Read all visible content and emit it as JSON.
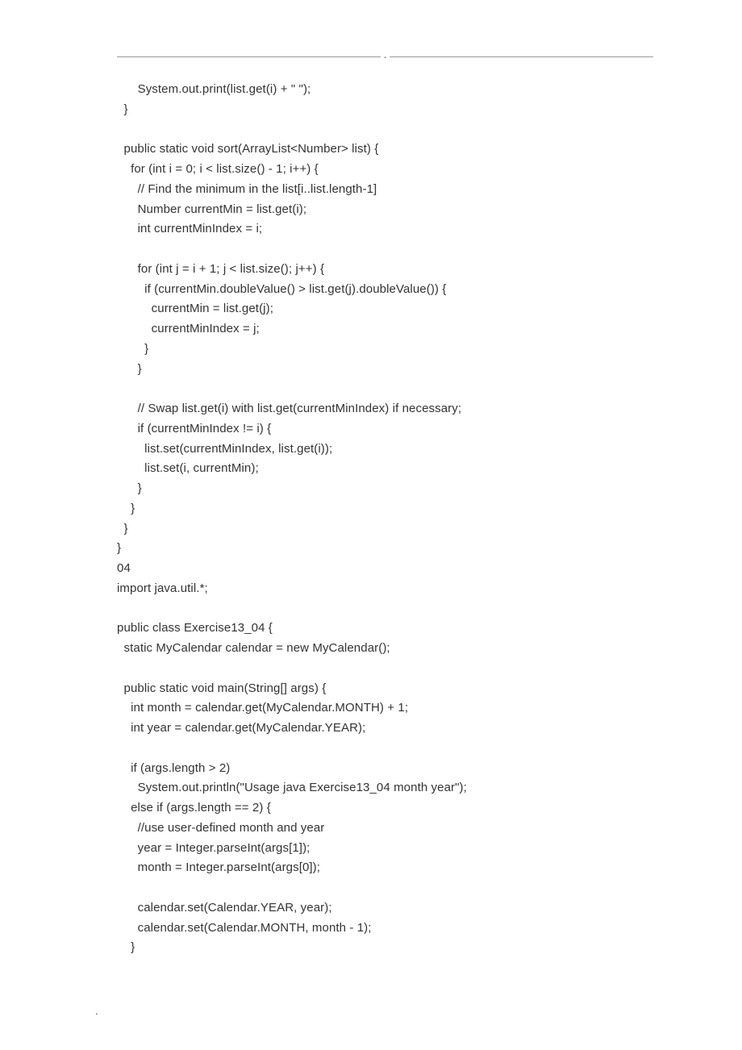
{
  "header": {
    "mark": "."
  },
  "footer": {
    "mark": "."
  },
  "code": {
    "lines": [
      "      System.out.print(list.get(i) + \" \");",
      "  }",
      "",
      "  public static void sort(ArrayList<Number> list) {",
      "    for (int i = 0; i < list.size() - 1; i++) {",
      "      // Find the minimum in the list[i..list.length-1]",
      "      Number currentMin = list.get(i);",
      "      int currentMinIndex = i;",
      "",
      "      for (int j = i + 1; j < list.size(); j++) {",
      "        if (currentMin.doubleValue() > list.get(j).doubleValue()) {",
      "          currentMin = list.get(j);",
      "          currentMinIndex = j;",
      "        }",
      "      }",
      "",
      "      // Swap list.get(i) with list.get(currentMinIndex) if necessary;",
      "      if (currentMinIndex != i) {",
      "        list.set(currentMinIndex, list.get(i));",
      "        list.set(i, currentMin);",
      "      }",
      "    }",
      "  }",
      "}",
      "04",
      "import java.util.*;",
      "",
      "public class Exercise13_04 {",
      "  static MyCalendar calendar = new MyCalendar();",
      "",
      "  public static void main(String[] args) {",
      "    int month = calendar.get(MyCalendar.MONTH) + 1;",
      "    int year = calendar.get(MyCalendar.YEAR);",
      "",
      "    if (args.length > 2)",
      "      System.out.println(\"Usage java Exercise13_04 month year\");",
      "    else if (args.length == 2) {",
      "      //use user-defined month and year",
      "      year = Integer.parseInt(args[1]);",
      "      month = Integer.parseInt(args[0]);",
      "",
      "      calendar.set(Calendar.YEAR, year);",
      "      calendar.set(Calendar.MONTH, month - 1);",
      "    }"
    ]
  }
}
